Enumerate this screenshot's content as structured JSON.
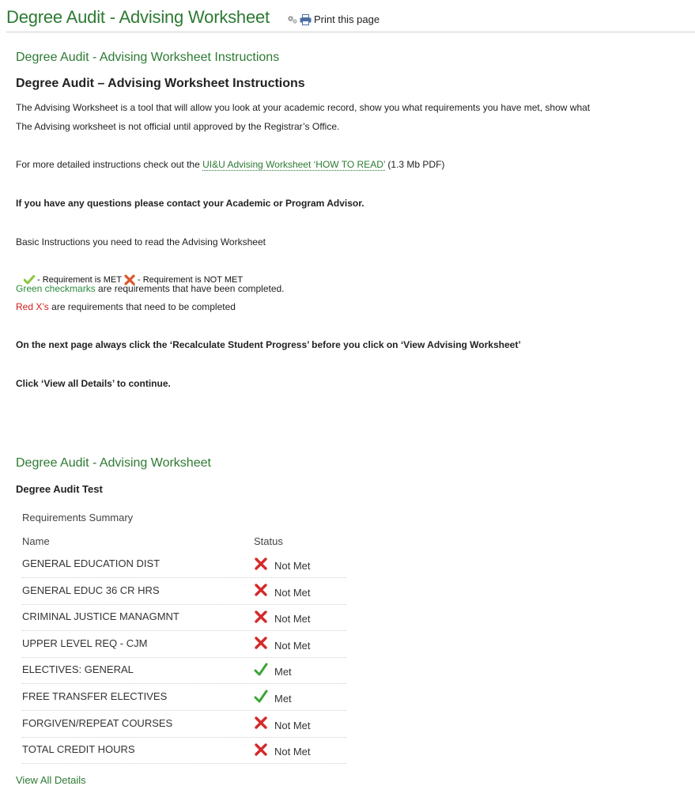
{
  "header": {
    "title": "Degree Audit - Advising Worksheet",
    "print_label": "Print this page"
  },
  "instructions": {
    "section_title": "Degree Audit - Advising Worksheet Instructions",
    "heading": "Degree Audit – Advising Worksheet Instructions",
    "para1": "The Advising Worksheet is a tool that will allow you look at your academic record, show you what requirements you have met, show what",
    "para2": "The Advising worksheet is not official until approved by the Registrar’s Office.",
    "more_prefix": "For more detailed instructions check out the ",
    "more_link": "UI&U Advising Worksheet ‘HOW TO READ’",
    "more_suffix": " (1.3 Mb PDF)",
    "questions": "If you have any questions please contact your Academic or Program Advisor.",
    "basic": "Basic Instructions you need to read the Advising Worksheet",
    "legend_met": " - Requirement is MET ",
    "legend_not_met": " - Requirement is NOT MET",
    "green_label": "Green checkmarks",
    "green_rest": " are requirements that have been completed.",
    "red_label": "Red X’s",
    "red_rest": " are requirements that need to be completed",
    "next_page": "On the next page always click the ‘Recalculate Student Progress’ before you  click on ‘View Advising Worksheet’",
    "view_all_note": "Click ‘View all Details’ to continue."
  },
  "worksheet": {
    "section_title": "Degree Audit - Advising Worksheet",
    "subtitle": "Degree Audit Test",
    "summary_label": "Requirements Summary",
    "col_name": "Name",
    "col_status": "Status",
    "rows": [
      {
        "name": "GENERAL EDUCATION DIST",
        "status": "Not Met"
      },
      {
        "name": "GENERAL EDUC 36 CR HRS",
        "status": "Not Met"
      },
      {
        "name": "CRIMINAL JUSTICE MANAGMNT",
        "status": "Not Met"
      },
      {
        "name": "UPPER LEVEL REQ - CJM",
        "status": "Not Met"
      },
      {
        "name": "ELECTIVES: GENERAL",
        "status": "Met"
      },
      {
        "name": "FREE TRANSFER ELECTIVES",
        "status": "Met"
      },
      {
        "name": "FORGIVEN/REPEAT COURSES",
        "status": "Not Met"
      },
      {
        "name": "TOTAL CREDIT HOURS",
        "status": "Not Met"
      }
    ],
    "view_all_label": "View All Details"
  },
  "colors": {
    "accent_green": "#2d7a33",
    "check_green": "#3aa635",
    "x_red": "#d42a2a"
  }
}
